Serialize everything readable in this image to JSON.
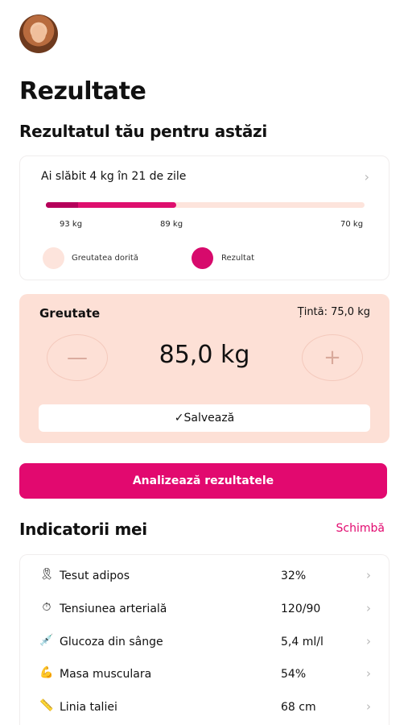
{
  "header": {
    "title": "Rezultate",
    "subtitle": "Rezultatul tău pentru astăzi"
  },
  "progress": {
    "headline": "Ai slăbit 4 kg în 21 de zile",
    "bar_fill_fraction": 0.41,
    "bar_dark_fraction": 0.1,
    "ticks": [
      "93 kg",
      "89 kg",
      "70 kg"
    ],
    "legend": {
      "desired": "Greutatea dorită",
      "result": "Rezultat"
    }
  },
  "weight": {
    "label": "Greutate",
    "target": "Țintă: 75,0 kg",
    "value": "85,0 kg",
    "minus": "—",
    "plus": "+",
    "save_label": "Salvează",
    "save_icon": "✓"
  },
  "actions": {
    "analyze_label": "Analizează rezultatele"
  },
  "indicators": {
    "title": "Indicatorii mei",
    "change_label": "Schimbă",
    "items": [
      {
        "icon": "🎗",
        "icon_name": "ribbon-icon",
        "label": "Tesut adipos",
        "value": "32%"
      },
      {
        "icon": "⏱",
        "icon_name": "gauge-icon",
        "label": "Tensiunea arterială",
        "value": "120/90"
      },
      {
        "icon": "💉",
        "icon_name": "syringe-icon",
        "label": "Glucoza din sânge",
        "value": "5,4 ml/l"
      },
      {
        "icon": "💪",
        "icon_name": "biceps-icon",
        "label": "Masa musculara",
        "value": "54%"
      },
      {
        "icon": "📏",
        "icon_name": "ruler-icon",
        "label": "Linia taliei",
        "value": "68 cm"
      }
    ]
  },
  "colors": {
    "accent": "#e2096f",
    "accent_dark": "#b5005a",
    "soft": "#fde0d6"
  },
  "chevron": "›"
}
